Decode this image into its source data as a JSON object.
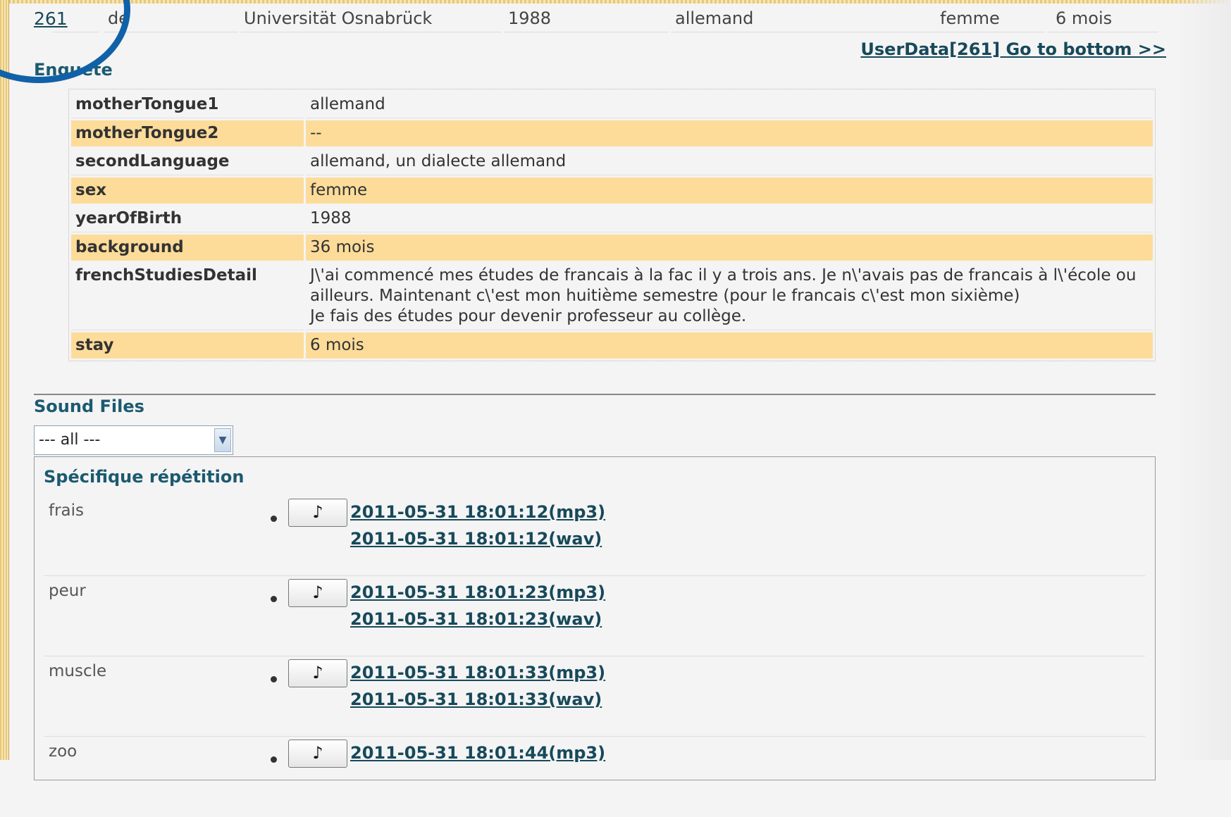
{
  "header": {
    "id": "261",
    "lang": "de",
    "university": "Universität Osnabrück",
    "year": "1988",
    "mother_tongue": "allemand",
    "sex": "femme",
    "stay": "6 mois",
    "goto_bottom": "UserData[261] Go to bottom >>"
  },
  "enquete": {
    "title": "Enquete",
    "rows": [
      {
        "key": "motherTongue1",
        "value": "allemand"
      },
      {
        "key": "motherTongue2",
        "value": "--"
      },
      {
        "key": "secondLanguage",
        "value": "allemand, un dialecte allemand"
      },
      {
        "key": "sex",
        "value": "femme"
      },
      {
        "key": "yearOfBirth",
        "value": "1988"
      },
      {
        "key": "background",
        "value": "36 mois"
      },
      {
        "key": "frenchStudiesDetail",
        "value": "J\\'ai commencé mes études de francais à la fac il y a trois ans. Je n\\'avais pas de francais à l\\'école ou ailleurs. Maintenant c\\'est mon huitième semestre (pour le francais c\\'est mon sixième)\nJe fais des études pour devenir professeur au collège."
      },
      {
        "key": "stay",
        "value": "6 mois"
      }
    ]
  },
  "sound_files": {
    "title": "Sound Files",
    "filter_value": "--- all ---",
    "panel_title": "Spécifique répétition",
    "play_symbol": "♪",
    "items": [
      {
        "word": "frais",
        "mp3": "2011-05-31 18:01:12(mp3)",
        "wav": "2011-05-31 18:01:12(wav)"
      },
      {
        "word": "peur",
        "mp3": "2011-05-31 18:01:23(mp3)",
        "wav": "2011-05-31 18:01:23(wav)"
      },
      {
        "word": "muscle",
        "mp3": "2011-05-31 18:01:33(mp3)",
        "wav": "2011-05-31 18:01:33(wav)"
      },
      {
        "word": "zoo",
        "mp3": "2011-05-31 18:01:44(mp3)",
        "wav": ""
      }
    ]
  }
}
